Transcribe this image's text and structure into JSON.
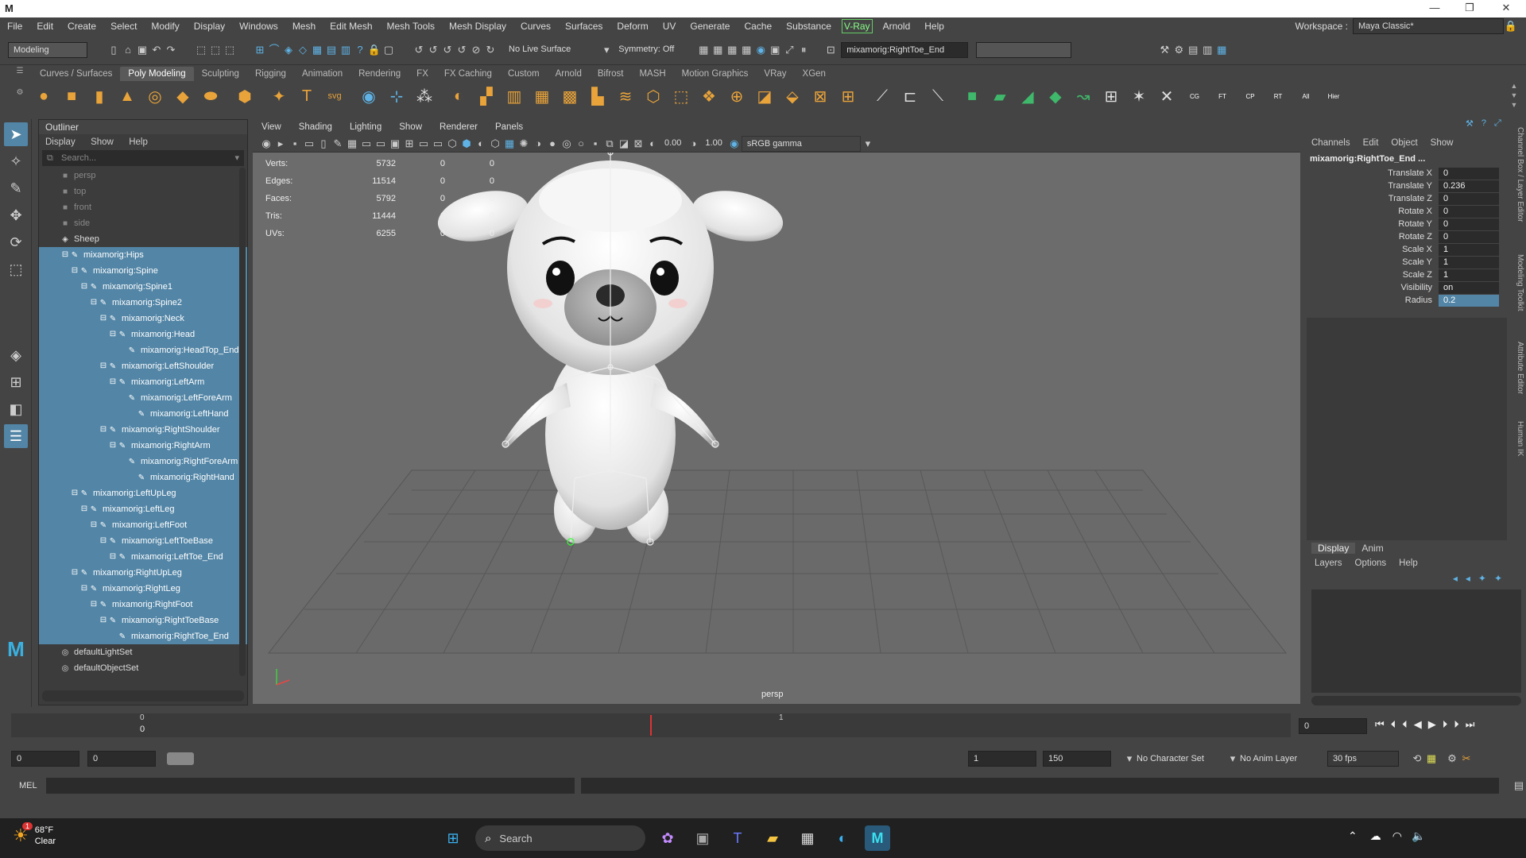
{
  "titlebar": {
    "logo": "M",
    "minimize": "—",
    "maximize": "❐",
    "close": "✕"
  },
  "menubar": [
    "File",
    "Edit",
    "Create",
    "Select",
    "Modify",
    "Display",
    "Windows",
    "Mesh",
    "Edit Mesh",
    "Mesh Tools",
    "Mesh Display",
    "Curves",
    "Surfaces",
    "Deform",
    "UV",
    "Generate",
    "Cache",
    "Substance",
    "V-Ray",
    "Arnold",
    "Help"
  ],
  "workspace": {
    "label": "Workspace :",
    "value": "Maya Classic*"
  },
  "statusline": {
    "mode": "Modeling",
    "live_surface": "No Live Surface",
    "symmetry": "Symmetry: Off",
    "selected_name": "mixamorig:RightToe_End"
  },
  "shelf_tabs": [
    "Curves / Surfaces",
    "Poly Modeling",
    "Sculpting",
    "Rigging",
    "Animation",
    "Rendering",
    "FX",
    "FX Caching",
    "Custom",
    "Arnold",
    "Bifrost",
    "MASH",
    "Motion Graphics",
    "VRay",
    "XGen"
  ],
  "shelf_active": "Poly Modeling",
  "shelf_labels": [
    "svg",
    "CG",
    "FT",
    "CP",
    "RT",
    "All",
    "Hier"
  ],
  "outliner": {
    "title": "Outliner",
    "menu": [
      "Display",
      "Show",
      "Help"
    ],
    "search_placeholder": "Search...",
    "rows": [
      {
        "label": "persp",
        "indent": 0,
        "icon": "■",
        "sel": false,
        "dim": true
      },
      {
        "label": "top",
        "indent": 0,
        "icon": "■",
        "sel": false,
        "dim": true
      },
      {
        "label": "front",
        "indent": 0,
        "icon": "■",
        "sel": false,
        "dim": true
      },
      {
        "label": "side",
        "indent": 0,
        "icon": "■",
        "sel": false,
        "dim": true
      },
      {
        "label": "Sheep",
        "indent": 0,
        "icon": "◈",
        "sel": false,
        "dim": false
      },
      {
        "label": "mixamorig:Hips",
        "indent": 1,
        "icon": "✎",
        "sel": true,
        "dim": false
      },
      {
        "label": "mixamorig:Spine",
        "indent": 2,
        "icon": "✎",
        "sel": true,
        "dim": false
      },
      {
        "label": "mixamorig:Spine1",
        "indent": 3,
        "icon": "✎",
        "sel": true,
        "dim": false
      },
      {
        "label": "mixamorig:Spine2",
        "indent": 4,
        "icon": "✎",
        "sel": true,
        "dim": false
      },
      {
        "label": "mixamorig:Neck",
        "indent": 5,
        "icon": "✎",
        "sel": true,
        "dim": false
      },
      {
        "label": "mixamorig:Head",
        "indent": 6,
        "icon": "✎",
        "sel": true,
        "dim": false
      },
      {
        "label": "mixamorig:HeadTop_End",
        "indent": 7,
        "icon": "✎",
        "sel": true,
        "dim": false
      },
      {
        "label": "mixamorig:LeftShoulder",
        "indent": 5,
        "icon": "✎",
        "sel": true,
        "dim": false
      },
      {
        "label": "mixamorig:LeftArm",
        "indent": 6,
        "icon": "✎",
        "sel": true,
        "dim": false
      },
      {
        "label": "mixamorig:LeftForeArm",
        "indent": 7,
        "icon": "✎",
        "sel": true,
        "dim": false
      },
      {
        "label": "mixamorig:LeftHand",
        "indent": 8,
        "icon": "✎",
        "sel": true,
        "dim": false
      },
      {
        "label": "mixamorig:RightShoulder",
        "indent": 5,
        "icon": "✎",
        "sel": true,
        "dim": false
      },
      {
        "label": "mixamorig:RightArm",
        "indent": 6,
        "icon": "✎",
        "sel": true,
        "dim": false
      },
      {
        "label": "mixamorig:RightForeArm",
        "indent": 7,
        "icon": "✎",
        "sel": true,
        "dim": false
      },
      {
        "label": "mixamorig:RightHand",
        "indent": 8,
        "icon": "✎",
        "sel": true,
        "dim": false
      },
      {
        "label": "mixamorig:LeftUpLeg",
        "indent": 2,
        "icon": "✎",
        "sel": true,
        "dim": false
      },
      {
        "label": "mixamorig:LeftLeg",
        "indent": 3,
        "icon": "✎",
        "sel": true,
        "dim": false
      },
      {
        "label": "mixamorig:LeftFoot",
        "indent": 4,
        "icon": "✎",
        "sel": true,
        "dim": false
      },
      {
        "label": "mixamorig:LeftToeBase",
        "indent": 5,
        "icon": "✎",
        "sel": true,
        "dim": false
      },
      {
        "label": "mixamorig:LeftToe_End",
        "indent": 6,
        "icon": "✎",
        "sel": true,
        "dim": false
      },
      {
        "label": "mixamorig:RightUpLeg",
        "indent": 2,
        "icon": "✎",
        "sel": true,
        "dim": false
      },
      {
        "label": "mixamorig:RightLeg",
        "indent": 3,
        "icon": "✎",
        "sel": true,
        "dim": false
      },
      {
        "label": "mixamorig:RightFoot",
        "indent": 4,
        "icon": "✎",
        "sel": true,
        "dim": false
      },
      {
        "label": "mixamorig:RightToeBase",
        "indent": 5,
        "icon": "✎",
        "sel": true,
        "dim": false
      },
      {
        "label": "mixamorig:RightToe_End",
        "indent": 6,
        "icon": "✎",
        "sel": true,
        "dim": false
      },
      {
        "label": "defaultLightSet",
        "indent": 0,
        "icon": "◎",
        "sel": false,
        "dim": false
      },
      {
        "label": "defaultObjectSet",
        "indent": 0,
        "icon": "◎",
        "sel": false,
        "dim": false
      }
    ]
  },
  "viewport": {
    "menu": [
      "View",
      "Shading",
      "Lighting",
      "Show",
      "Renderer",
      "Panels"
    ],
    "exposure": "0.00",
    "gamma": "1.00",
    "colorspace": "sRGB gamma",
    "camera": "persp",
    "stats": [
      {
        "name": "Verts:",
        "a": "5732",
        "b": "0",
        "c": "0"
      },
      {
        "name": "Edges:",
        "a": "11514",
        "b": "0",
        "c": "0"
      },
      {
        "name": "Faces:",
        "a": "5792",
        "b": "0",
        "c": "0"
      },
      {
        "name": "Tris:",
        "a": "11444",
        "b": "0",
        "c": "0"
      },
      {
        "name": "UVs:",
        "a": "6255",
        "b": "0",
        "c": "0"
      }
    ]
  },
  "channelbox": {
    "menu": [
      "Channels",
      "Edit",
      "Object",
      "Show"
    ],
    "node": "mixamorig:RightToe_End ...",
    "attrs": [
      {
        "name": "Translate X",
        "value": "0",
        "hl": false
      },
      {
        "name": "Translate Y",
        "value": "0.236",
        "hl": false
      },
      {
        "name": "Translate Z",
        "value": "0",
        "hl": false
      },
      {
        "name": "Rotate X",
        "value": "0",
        "hl": false
      },
      {
        "name": "Rotate Y",
        "value": "0",
        "hl": false
      },
      {
        "name": "Rotate Z",
        "value": "0",
        "hl": false
      },
      {
        "name": "Scale X",
        "value": "1",
        "hl": false
      },
      {
        "name": "Scale Y",
        "value": "1",
        "hl": false
      },
      {
        "name": "Scale Z",
        "value": "1",
        "hl": false
      },
      {
        "name": "Visibility",
        "value": "on",
        "hl": false
      },
      {
        "name": "Radius",
        "value": "0.2",
        "hl": true
      }
    ],
    "side_tabs": [
      "Channel Box / Layer Editor",
      "Modeling Toolkit",
      "Attribute Editor",
      "Human IK"
    ],
    "layer_tabs": [
      "Display",
      "Anim"
    ],
    "layer_menu": [
      "Layers",
      "Options",
      "Help"
    ]
  },
  "timeslider": {
    "tick0": "0",
    "frame0": "0",
    "tick1": "1",
    "current_frame": "0"
  },
  "rangebar": {
    "start": "0",
    "start2": "0",
    "range_start": "1",
    "range_end": "150",
    "character_set": "No Character Set",
    "anim_layer": "No Anim Layer",
    "fps": "30 fps"
  },
  "cmdline": {
    "label": "MEL"
  },
  "taskbar": {
    "temp": "68°F",
    "weather": "Clear",
    "search": "Search",
    "badge": "1"
  }
}
